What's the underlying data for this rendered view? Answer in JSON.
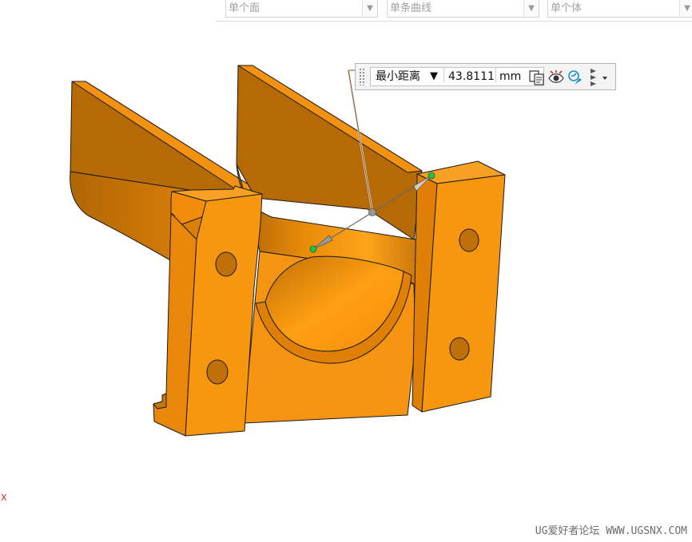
{
  "selection_filters": [
    {
      "value": "单个面"
    },
    {
      "value": "单条曲线"
    },
    {
      "value": "单个体"
    }
  ],
  "measure_toolbar": {
    "mode": "最小距离",
    "mode_caret": "▼",
    "distance_value": "43.8111",
    "unit": "mm",
    "icons": [
      "copy-measure-icon",
      "show-measure-icon",
      "measure-options-icon",
      "more-options-icon"
    ]
  },
  "viewport": {
    "part_color": "#f7960f",
    "part_shade_color": "#b36b06",
    "endpoint_color": "#22c24a",
    "axis_label": "X"
  },
  "watermark": "UG爱好者论坛 WWW.UGSNX.COM"
}
